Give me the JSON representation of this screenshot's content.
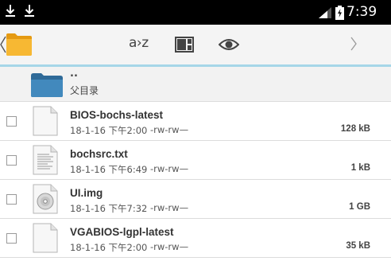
{
  "status_bar": {
    "notifications": [
      "download-icon",
      "download-icon"
    ],
    "signal": "signal-icon",
    "battery": "battery-charging-icon",
    "time": "7:39"
  },
  "action_bar": {
    "back": "back-chevron-icon",
    "folder": "folder-icon",
    "sort_label": "a›z",
    "view_icon": "view-mode-icon",
    "visibility_icon": "eye-icon",
    "next": "next-chevron-icon"
  },
  "parent": {
    "dots": "..",
    "label": "父目录"
  },
  "files": [
    {
      "name": "BIOS-bochs-latest",
      "date": "18-1-16 下午2:00",
      "perms": "-rw-rw—",
      "size": "128 kB",
      "icon": "blank-file-icon"
    },
    {
      "name": "bochsrc.txt",
      "date": "18-1-16 下午6:49",
      "perms": "-rw-rw—",
      "size": "1 kB",
      "icon": "text-file-icon"
    },
    {
      "name": "UI.img",
      "date": "18-1-16 下午7:32",
      "perms": "-rw-rw—",
      "size": "1 GB",
      "icon": "disk-image-icon"
    },
    {
      "name": "VGABIOS-lgpl-latest",
      "date": "18-1-16 下午2:00",
      "perms": "-rw-rw—",
      "size": "35 kB",
      "icon": "blank-file-icon"
    }
  ],
  "colors": {
    "accent_line": "#a6d6e8",
    "folder_blue": "#3d7fb0",
    "folder_yellow": "#f7b833"
  }
}
